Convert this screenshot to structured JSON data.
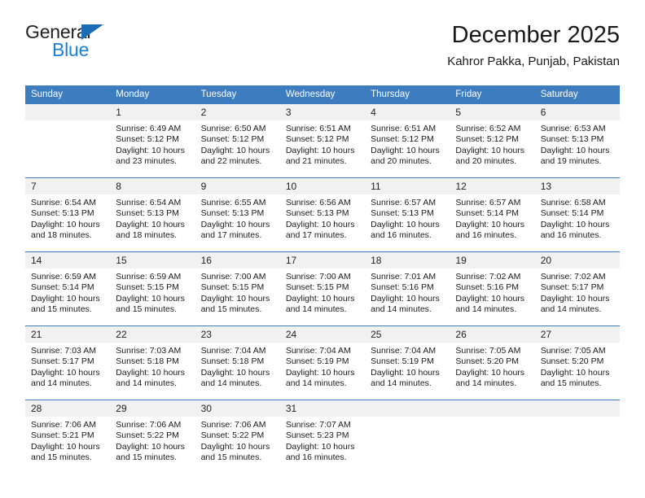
{
  "brand": {
    "line1": "General",
    "line2": "Blue",
    "icon": "triangle-logo"
  },
  "header": {
    "title": "December 2025",
    "location": "Kahror Pakka, Punjab, Pakistan"
  },
  "colors": {
    "header_blue": "#3d7cbf",
    "daynum_bg": "#f1f1f1",
    "brand_blue": "#1b7fd4",
    "logo_blue": "#1b6cb5"
  },
  "weekday_headers": [
    "Sunday",
    "Monday",
    "Tuesday",
    "Wednesday",
    "Thursday",
    "Friday",
    "Saturday"
  ],
  "weeks": [
    [
      {
        "day": "",
        "sunrise": "",
        "sunset": "",
        "daylight_a": "",
        "daylight_b": ""
      },
      {
        "day": "1",
        "sunrise": "Sunrise: 6:49 AM",
        "sunset": "Sunset: 5:12 PM",
        "daylight_a": "Daylight: 10 hours",
        "daylight_b": "and 23 minutes."
      },
      {
        "day": "2",
        "sunrise": "Sunrise: 6:50 AM",
        "sunset": "Sunset: 5:12 PM",
        "daylight_a": "Daylight: 10 hours",
        "daylight_b": "and 22 minutes."
      },
      {
        "day": "3",
        "sunrise": "Sunrise: 6:51 AM",
        "sunset": "Sunset: 5:12 PM",
        "daylight_a": "Daylight: 10 hours",
        "daylight_b": "and 21 minutes."
      },
      {
        "day": "4",
        "sunrise": "Sunrise: 6:51 AM",
        "sunset": "Sunset: 5:12 PM",
        "daylight_a": "Daylight: 10 hours",
        "daylight_b": "and 20 minutes."
      },
      {
        "day": "5",
        "sunrise": "Sunrise: 6:52 AM",
        "sunset": "Sunset: 5:12 PM",
        "daylight_a": "Daylight: 10 hours",
        "daylight_b": "and 20 minutes."
      },
      {
        "day": "6",
        "sunrise": "Sunrise: 6:53 AM",
        "sunset": "Sunset: 5:13 PM",
        "daylight_a": "Daylight: 10 hours",
        "daylight_b": "and 19 minutes."
      }
    ],
    [
      {
        "day": "7",
        "sunrise": "Sunrise: 6:54 AM",
        "sunset": "Sunset: 5:13 PM",
        "daylight_a": "Daylight: 10 hours",
        "daylight_b": "and 18 minutes."
      },
      {
        "day": "8",
        "sunrise": "Sunrise: 6:54 AM",
        "sunset": "Sunset: 5:13 PM",
        "daylight_a": "Daylight: 10 hours",
        "daylight_b": "and 18 minutes."
      },
      {
        "day": "9",
        "sunrise": "Sunrise: 6:55 AM",
        "sunset": "Sunset: 5:13 PM",
        "daylight_a": "Daylight: 10 hours",
        "daylight_b": "and 17 minutes."
      },
      {
        "day": "10",
        "sunrise": "Sunrise: 6:56 AM",
        "sunset": "Sunset: 5:13 PM",
        "daylight_a": "Daylight: 10 hours",
        "daylight_b": "and 17 minutes."
      },
      {
        "day": "11",
        "sunrise": "Sunrise: 6:57 AM",
        "sunset": "Sunset: 5:13 PM",
        "daylight_a": "Daylight: 10 hours",
        "daylight_b": "and 16 minutes."
      },
      {
        "day": "12",
        "sunrise": "Sunrise: 6:57 AM",
        "sunset": "Sunset: 5:14 PM",
        "daylight_a": "Daylight: 10 hours",
        "daylight_b": "and 16 minutes."
      },
      {
        "day": "13",
        "sunrise": "Sunrise: 6:58 AM",
        "sunset": "Sunset: 5:14 PM",
        "daylight_a": "Daylight: 10 hours",
        "daylight_b": "and 16 minutes."
      }
    ],
    [
      {
        "day": "14",
        "sunrise": "Sunrise: 6:59 AM",
        "sunset": "Sunset: 5:14 PM",
        "daylight_a": "Daylight: 10 hours",
        "daylight_b": "and 15 minutes."
      },
      {
        "day": "15",
        "sunrise": "Sunrise: 6:59 AM",
        "sunset": "Sunset: 5:15 PM",
        "daylight_a": "Daylight: 10 hours",
        "daylight_b": "and 15 minutes."
      },
      {
        "day": "16",
        "sunrise": "Sunrise: 7:00 AM",
        "sunset": "Sunset: 5:15 PM",
        "daylight_a": "Daylight: 10 hours",
        "daylight_b": "and 15 minutes."
      },
      {
        "day": "17",
        "sunrise": "Sunrise: 7:00 AM",
        "sunset": "Sunset: 5:15 PM",
        "daylight_a": "Daylight: 10 hours",
        "daylight_b": "and 14 minutes."
      },
      {
        "day": "18",
        "sunrise": "Sunrise: 7:01 AM",
        "sunset": "Sunset: 5:16 PM",
        "daylight_a": "Daylight: 10 hours",
        "daylight_b": "and 14 minutes."
      },
      {
        "day": "19",
        "sunrise": "Sunrise: 7:02 AM",
        "sunset": "Sunset: 5:16 PM",
        "daylight_a": "Daylight: 10 hours",
        "daylight_b": "and 14 minutes."
      },
      {
        "day": "20",
        "sunrise": "Sunrise: 7:02 AM",
        "sunset": "Sunset: 5:17 PM",
        "daylight_a": "Daylight: 10 hours",
        "daylight_b": "and 14 minutes."
      }
    ],
    [
      {
        "day": "21",
        "sunrise": "Sunrise: 7:03 AM",
        "sunset": "Sunset: 5:17 PM",
        "daylight_a": "Daylight: 10 hours",
        "daylight_b": "and 14 minutes."
      },
      {
        "day": "22",
        "sunrise": "Sunrise: 7:03 AM",
        "sunset": "Sunset: 5:18 PM",
        "daylight_a": "Daylight: 10 hours",
        "daylight_b": "and 14 minutes."
      },
      {
        "day": "23",
        "sunrise": "Sunrise: 7:04 AM",
        "sunset": "Sunset: 5:18 PM",
        "daylight_a": "Daylight: 10 hours",
        "daylight_b": "and 14 minutes."
      },
      {
        "day": "24",
        "sunrise": "Sunrise: 7:04 AM",
        "sunset": "Sunset: 5:19 PM",
        "daylight_a": "Daylight: 10 hours",
        "daylight_b": "and 14 minutes."
      },
      {
        "day": "25",
        "sunrise": "Sunrise: 7:04 AM",
        "sunset": "Sunset: 5:19 PM",
        "daylight_a": "Daylight: 10 hours",
        "daylight_b": "and 14 minutes."
      },
      {
        "day": "26",
        "sunrise": "Sunrise: 7:05 AM",
        "sunset": "Sunset: 5:20 PM",
        "daylight_a": "Daylight: 10 hours",
        "daylight_b": "and 14 minutes."
      },
      {
        "day": "27",
        "sunrise": "Sunrise: 7:05 AM",
        "sunset": "Sunset: 5:20 PM",
        "daylight_a": "Daylight: 10 hours",
        "daylight_b": "and 15 minutes."
      }
    ],
    [
      {
        "day": "28",
        "sunrise": "Sunrise: 7:06 AM",
        "sunset": "Sunset: 5:21 PM",
        "daylight_a": "Daylight: 10 hours",
        "daylight_b": "and 15 minutes."
      },
      {
        "day": "29",
        "sunrise": "Sunrise: 7:06 AM",
        "sunset": "Sunset: 5:22 PM",
        "daylight_a": "Daylight: 10 hours",
        "daylight_b": "and 15 minutes."
      },
      {
        "day": "30",
        "sunrise": "Sunrise: 7:06 AM",
        "sunset": "Sunset: 5:22 PM",
        "daylight_a": "Daylight: 10 hours",
        "daylight_b": "and 15 minutes."
      },
      {
        "day": "31",
        "sunrise": "Sunrise: 7:07 AM",
        "sunset": "Sunset: 5:23 PM",
        "daylight_a": "Daylight: 10 hours",
        "daylight_b": "and 16 minutes."
      },
      {
        "day": "",
        "sunrise": "",
        "sunset": "",
        "daylight_a": "",
        "daylight_b": ""
      },
      {
        "day": "",
        "sunrise": "",
        "sunset": "",
        "daylight_a": "",
        "daylight_b": ""
      },
      {
        "day": "",
        "sunrise": "",
        "sunset": "",
        "daylight_a": "",
        "daylight_b": ""
      }
    ]
  ]
}
